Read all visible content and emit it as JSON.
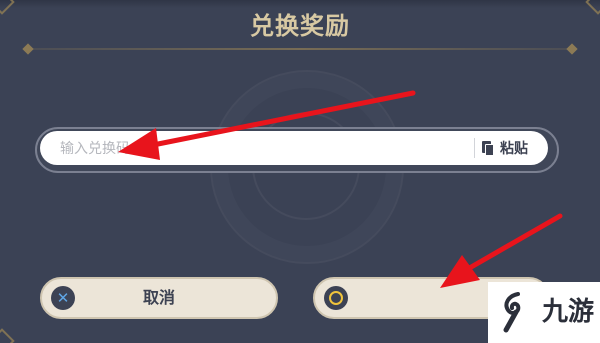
{
  "dialog": {
    "title": "兑换奖励"
  },
  "code_input": {
    "placeholder": "输入兑换码",
    "value": ""
  },
  "paste": {
    "label": "粘贴",
    "icon": "paste-icon"
  },
  "buttons": {
    "cancel_label": "取消",
    "cancel_icon": "close-icon",
    "confirm_label": "",
    "confirm_icon": "confirm-circle-icon"
  },
  "watermark": {
    "text": "九游"
  },
  "colors": {
    "background": "#3b4255",
    "title": "#d8c9a3",
    "button_fill": "#ece5d8",
    "annotation_arrow": "#e8141c",
    "cancel_icon_color": "#5fa5e5",
    "confirm_icon_color": "#f0c43c"
  }
}
